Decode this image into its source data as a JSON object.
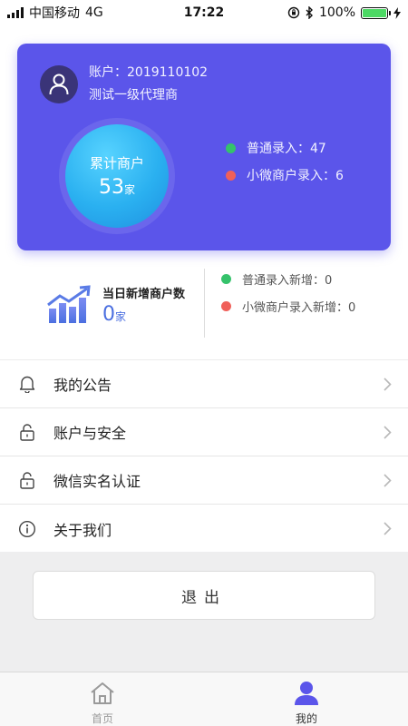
{
  "status_bar": {
    "carrier": "中国移动",
    "network": "4G",
    "time": "17:22",
    "battery": "100%",
    "battery_level": 1.0
  },
  "account_card": {
    "account_text": "账户：2019110102",
    "agent_name": "测试一级代理商",
    "total_label": "累计商户",
    "total_value": "53",
    "total_unit": "家",
    "legend": [
      {
        "label": "普通录入：47",
        "color": "#35c26b"
      },
      {
        "label": "小微商户录入：6",
        "color": "#f0605a"
      }
    ],
    "colors": {
      "card": "#5b55ea",
      "circle": "#2ab0f0"
    }
  },
  "daily": {
    "title": "当日新增商户数",
    "value": "0",
    "unit": "家",
    "legend": [
      {
        "label": "普通录入新增：0",
        "color": "#35c26b"
      },
      {
        "label": "小微商户录入新增：0",
        "color": "#f0605a"
      }
    ]
  },
  "menu": {
    "items": [
      {
        "label": "我的公告",
        "icon": "bell-icon"
      },
      {
        "label": "账户与安全",
        "icon": "lock-icon"
      },
      {
        "label": "微信实名认证",
        "icon": "lock-icon"
      },
      {
        "label": "关于我们",
        "icon": "info-icon"
      }
    ]
  },
  "logout": {
    "label": "退出"
  },
  "tabbar": {
    "tabs": [
      {
        "label": "首页",
        "icon": "home-icon",
        "active": false
      },
      {
        "label": "我的",
        "icon": "user-icon",
        "active": true
      }
    ],
    "colors": {
      "active": "#5b55ea",
      "inactive": "#9a9a9a"
    }
  }
}
